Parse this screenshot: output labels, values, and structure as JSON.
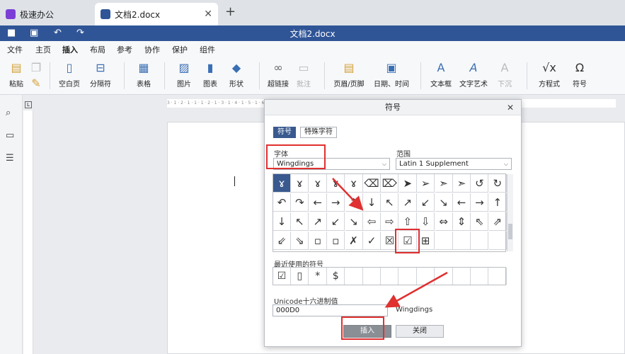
{
  "tabs": [
    {
      "label": "极速办公"
    },
    {
      "label": "文档2.docx"
    }
  ],
  "window": {
    "title": "文档2.docx"
  },
  "menu": [
    "文件",
    "主页",
    "插入",
    "布局",
    "参考",
    "协作",
    "保护",
    "组件"
  ],
  "ribbon": {
    "paste": "粘贴",
    "blank_page": "空白页",
    "page_break": "分隔符",
    "table": "表格",
    "picture": "图片",
    "chart": "图表",
    "shape": "形状",
    "hyperlink": "超链接",
    "comment": "批注",
    "header_footer": "页眉/页脚",
    "date_time": "日期、时间",
    "textbox": "文本框",
    "text_art": "文字艺术",
    "drop_cap": "下沉",
    "equation": "方程式",
    "symbol": "符号"
  },
  "ruler": {
    "marks": "3 · 1 · 2 · 1 · 1 · 1 · 2 · 1 · 3 · 1 · 4 · 1 · 5 · 1 · 6 · 1 · 7 · 1 · 8 · 1 · 9 · 1 · 10 · 1 · 11 · 1 · 12 · 1 · 13 · 1 · 14 · 1 · 15 · 1 · 16 · 1 · 17 · 1 · 18"
  },
  "dialog": {
    "title": "符号",
    "tab_symbol": "符号",
    "tab_special": "特殊字符",
    "font_label": "字体",
    "font_value": "Wingdings",
    "range_label": "范围",
    "range_value": "Latin 1 Supplement",
    "symbols": [
      "ɤ",
      "ɤ",
      "ɤ",
      "ɤ",
      "ɤ",
      "⌫",
      "⌦",
      "➤",
      "➢",
      "➣",
      "➣",
      "↺",
      "↻",
      "↶",
      "↷",
      "←",
      "→",
      "↑",
      "↓",
      "↖",
      "↗",
      "↙",
      "↘",
      "←",
      "→",
      "↑",
      "↓",
      "↖",
      "↗",
      "↙",
      "↘",
      "⇦",
      "⇨",
      "⇧",
      "⇩",
      "⇔",
      "⇕",
      "⇖",
      "⇗",
      "⇙",
      "⇘",
      "▫",
      "▫",
      "✗",
      "✓",
      "☒",
      "☑",
      "⊞",
      "",
      "",
      "",
      ""
    ],
    "recent_label": "最近使用的符号",
    "recent": [
      "☑",
      "▯",
      "*",
      "$",
      "",
      "",
      "",
      "",
      "",
      "",
      "",
      "",
      ""
    ],
    "unicode_label": "Unicode十六进制值",
    "unicode_value": "000D0",
    "unicode_font": "Wingdings",
    "insert": "插入",
    "close": "关闭"
  },
  "colors": {
    "accent": "#2f5597",
    "highlight": "#e03030"
  }
}
